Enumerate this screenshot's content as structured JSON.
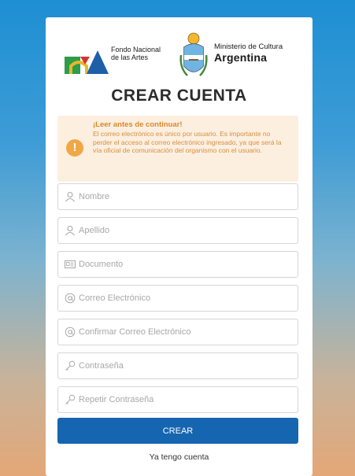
{
  "logos": {
    "fna_text": "Fondo Nacional\nde las Artes",
    "ministry_line1": "Ministerio de Cultura",
    "ministry_line2": "Argentina"
  },
  "page": {
    "title": "CREAR CUENTA"
  },
  "notice": {
    "icon": "exclamation-icon",
    "title": "¡Leer antes de continuar!",
    "body": "El correo electrónico es único por usuario. Es importante no perder el acceso al correo electrónico ingresado, ya que será la vía oficial de comunicación del organismo con el usuario."
  },
  "form": {
    "nombre": {
      "placeholder": "Nombre",
      "icon": "user-icon"
    },
    "apellido": {
      "placeholder": "Apellido",
      "icon": "user-icon"
    },
    "documento": {
      "placeholder": "Documento",
      "icon": "id-card-icon"
    },
    "correo": {
      "placeholder": "Correo Electrónico",
      "icon": "at-icon"
    },
    "confirmar_correo": {
      "placeholder": "Confirmar Correo Electrónico",
      "icon": "at-icon"
    },
    "contrasena": {
      "placeholder": "Contraseña",
      "icon": "key-icon"
    },
    "repetir_contrasena": {
      "placeholder": "Repetir Contraseña",
      "icon": "key-icon"
    },
    "submit_label": "CREAR",
    "login_link": "Ya tengo cuenta"
  },
  "colors": {
    "primary_button": "#1565b0",
    "notice_bg": "#fcefe0",
    "notice_accent": "#f0a847"
  }
}
